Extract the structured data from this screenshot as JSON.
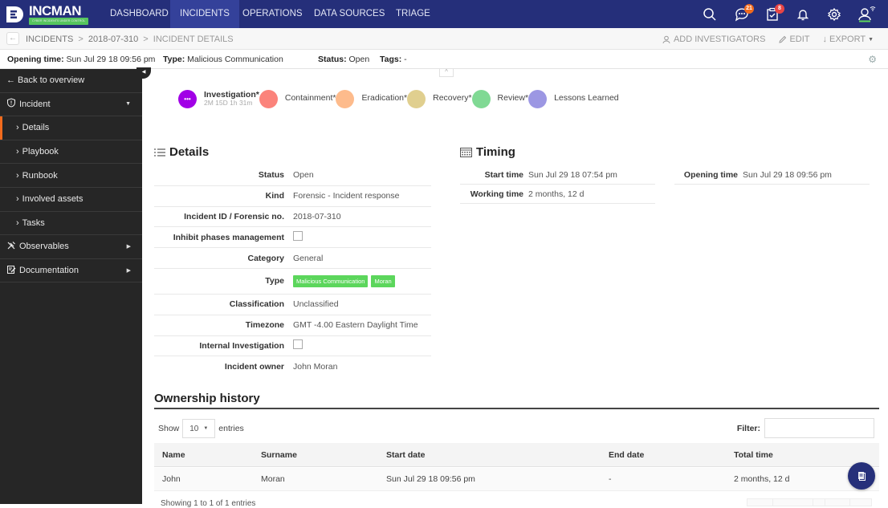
{
  "app": {
    "brand": "INCMAN",
    "tagline": "CYBER INCIDENTS UNDER CONTROL"
  },
  "topnav": {
    "items": [
      {
        "label": "DASHBOARD",
        "active": false
      },
      {
        "label": "INCIDENTS",
        "active": true
      },
      {
        "label": "OPERATIONS",
        "active": false
      },
      {
        "label": "DATA SOURCES",
        "active": false
      },
      {
        "label": "TRIAGE",
        "active": false
      }
    ],
    "icons": {
      "search": "search-icon",
      "messages": {
        "icon": "chat-icon",
        "badge": "21",
        "badge_color": "#f26b1d"
      },
      "tasks": {
        "icon": "clipboard-check-icon",
        "badge": "8",
        "badge_color": "#e84545"
      },
      "notifications": "bell-icon",
      "settings": "gear-icon",
      "user": "user-icon"
    }
  },
  "breadcrumb": {
    "items": [
      "INCIDENTS",
      "2018-07-310",
      "INCIDENT DETAILS"
    ],
    "separator": ">"
  },
  "actions": {
    "add_investigators": "ADD INVESTIGATORS",
    "edit": "EDIT",
    "export": "EXPORT"
  },
  "infobar": {
    "opening_label": "Opening time:",
    "opening_value": "Sun Jul 29 18 09:56 pm",
    "type_label": "Type:",
    "type_value": "Malicious Communication",
    "status_label": "Status:",
    "status_value": "Open",
    "tags_label": "Tags:",
    "tags_value": "-"
  },
  "sidebar": {
    "back": "← Back to overview",
    "items": [
      {
        "label": "Incident",
        "type": "section",
        "expanded": true
      },
      {
        "label": "Details",
        "type": "sub",
        "active": true
      },
      {
        "label": "Playbook",
        "type": "sub"
      },
      {
        "label": "Runbook",
        "type": "sub"
      },
      {
        "label": "Involved assets",
        "type": "sub"
      },
      {
        "label": "Tasks",
        "type": "sub"
      },
      {
        "label": "Observables",
        "type": "section",
        "expanded": false
      },
      {
        "label": "Documentation",
        "type": "section",
        "expanded": false
      }
    ]
  },
  "phases": [
    {
      "name": "Investigation*",
      "time": "2M 15D 1h 31m",
      "color": "#a100e6",
      "current": true
    },
    {
      "name": "Containment*",
      "color": "#fb837b"
    },
    {
      "name": "Eradication*",
      "color": "#fdbb8c"
    },
    {
      "name": "Recovery*",
      "color": "#e0cf8f"
    },
    {
      "name": "Review*",
      "color": "#80d994"
    },
    {
      "name": "Lessons Learned",
      "color": "#9c97e3"
    }
  ],
  "details": {
    "title": "Details",
    "rows": [
      {
        "label": "Status",
        "value": "Open"
      },
      {
        "label": "Kind",
        "value": "Forensic - Incident response"
      },
      {
        "label": "Incident ID / Forensic no.",
        "value": "2018-07-310"
      },
      {
        "label": "Inhibit phases management",
        "checkbox": false
      },
      {
        "label": "Category",
        "value": "General"
      },
      {
        "label": "Type",
        "tags": [
          "Malicious Communication",
          "Moran"
        ]
      },
      {
        "label": "Classification",
        "value": "Unclassified"
      },
      {
        "label": "Timezone",
        "value": "GMT -4.00 Eastern Daylight Time"
      },
      {
        "label": "Internal Investigation",
        "checkbox": false
      },
      {
        "label": "Incident owner",
        "value": "John Moran"
      }
    ]
  },
  "timing": {
    "title": "Timing",
    "start_label": "Start time",
    "start_value": "Sun Jul 29 18 07:54 pm",
    "working_label": "Working time",
    "working_value": "2 months, 12 d",
    "opening_label": "Opening time",
    "opening_value": "Sun Jul 29 18 09:56 pm"
  },
  "ownership": {
    "title": "Ownership history",
    "show_label": "Show",
    "entries_value": "10",
    "entries_label": "entries",
    "filter_label": "Filter:",
    "filter_value": "",
    "columns": [
      "Name",
      "Surname",
      "Start date",
      "End date",
      "Total time"
    ],
    "rows": [
      [
        "John",
        "Moran",
        "Sun Jul 29 18 09:56 pm",
        "-",
        "2 months, 12 d"
      ]
    ],
    "footer": "Showing 1 to 1 of 1 entries"
  }
}
